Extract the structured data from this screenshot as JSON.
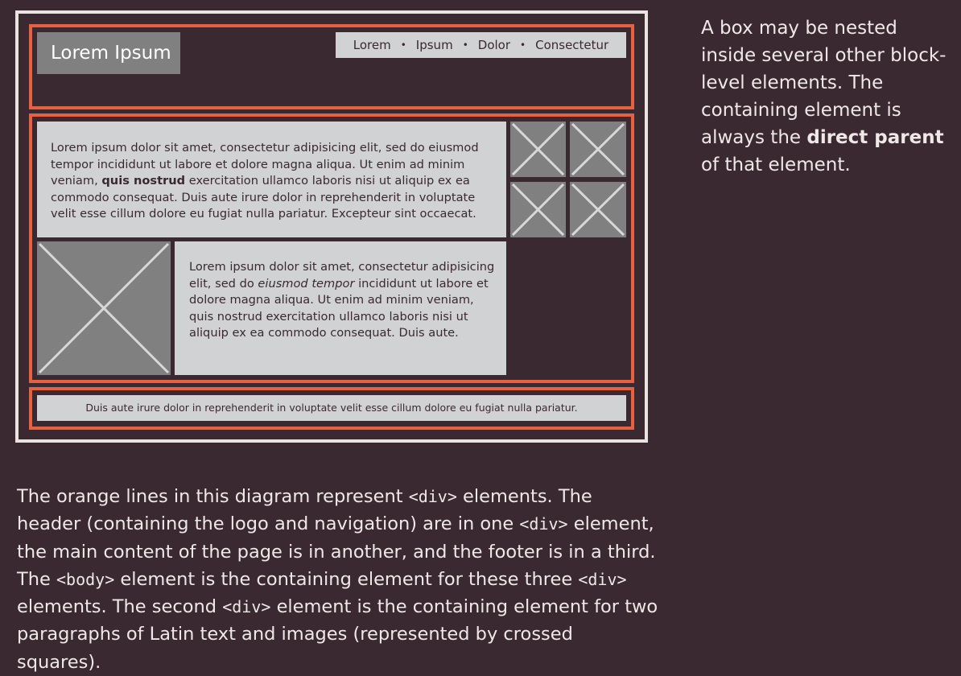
{
  "diagram": {
    "header": {
      "logo": "Lorem Ipsum",
      "nav": [
        "Lorem",
        "Ipsum",
        "Dolor",
        "Consectetur"
      ],
      "nav_separator": "•"
    },
    "main": {
      "paragraph1": {
        "before_bold": "Lorem ipsum dolor sit amet, consectetur adipisicing elit, sed do eiusmod tempor incididunt ut labore et dolore magna aliqua. Ut enim ad minim veniam, ",
        "bold": "quis nostrud",
        "after_bold": " exercitation ullamco laboris nisi ut aliquip ex ea commodo consequat. Duis aute irure dolor in reprehenderit in voluptate velit esse cillum dolore eu fugiat nulla pariatur. Excepteur sint occaecat."
      },
      "paragraph2": {
        "before_italic": "Lorem ipsum dolor sit amet, consectetur adipisicing elit, sed do ",
        "italic": "eiusmod tempor",
        "after_italic": " incididunt ut labore et dolore magna aliqua. Ut enim ad minim veniam, quis nostrud exercitation ullamco laboris nisi ut aliquip ex ea commodo consequat. Duis aute."
      }
    },
    "footer": {
      "text": "Duis aute irure dolor in reprehenderit in voluptate velit esse cillum dolore eu fugiat nulla pariatur."
    }
  },
  "side_note": {
    "before_bold": "A box may be nested inside several other block-level elements. The containing element is always the ",
    "bold": "direct parent",
    "after_bold": " of that element."
  },
  "caption": {
    "part1": "The orange lines in this diagram represent ",
    "code1": "<div>",
    "part2": " elements. The header (containing the logo and navigation) are in one ",
    "code2": "<div>",
    "part3": " element, the main content of the page is in another, and the footer is in a third. The ",
    "code3": "<body>",
    "part4": " element is the containing element for these three ",
    "code4": "<div>",
    "part5": " elements. The second ",
    "code5": "<div>",
    "part6": " element is the containing element for two paragraphs of Latin text and images (represented by crossed squares)."
  },
  "colors": {
    "background": "#3a2930",
    "div_outline": "#e5613f",
    "body_outline": "#e8e4df",
    "panel": "#d1d2d4",
    "image_placeholder": "#808080"
  }
}
